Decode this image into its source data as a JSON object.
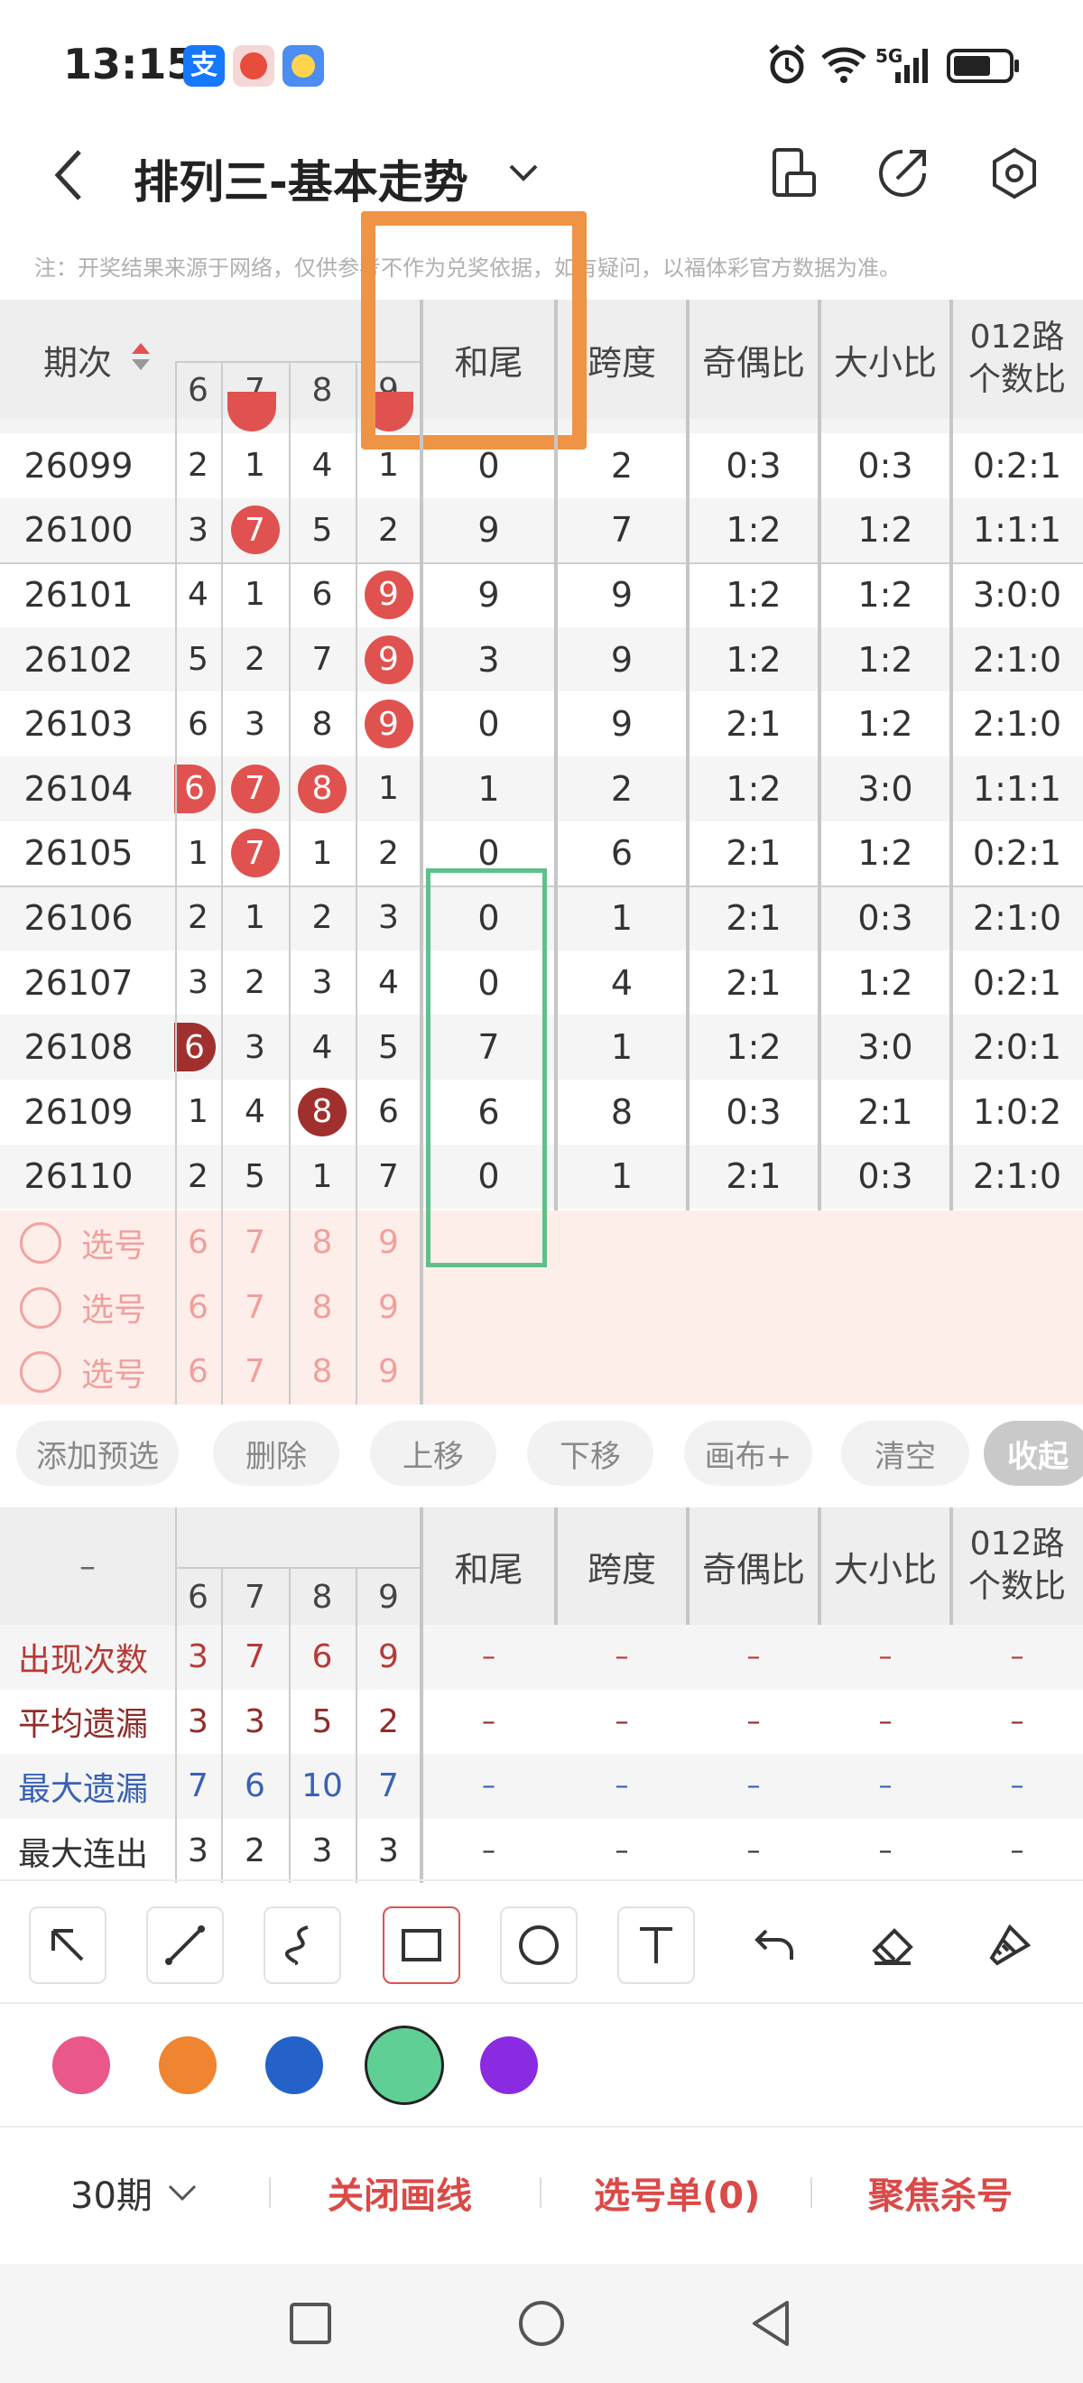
{
  "status": {
    "time": "13:15",
    "signal": "5G"
  },
  "header": {
    "title": "排列三-基本走势"
  },
  "note": "注：开奖结果来源于网络，仅供参考不作为兑奖依据，如有疑问，以福体彩官方数据为准。",
  "table": {
    "col_issue": "期次",
    "digit_cols": [
      "6",
      "7",
      "8",
      "9"
    ],
    "col_headers": [
      "和尾",
      "跨度",
      "奇偶比",
      "大小比"
    ],
    "col_012": [
      "012路",
      "个数比"
    ],
    "rows": [
      {
        "issue": "26099",
        "d": [
          "2",
          "1",
          "4",
          "1"
        ],
        "sum_tail": "0",
        "span": "2",
        "odd_even": "0:3",
        "big_small": "0:3",
        "r012": "0:2:1"
      },
      {
        "issue": "26100",
        "d": [
          "3",
          "7",
          "5",
          "2"
        ],
        "sum_tail": "9",
        "span": "7",
        "odd_even": "1:2",
        "big_small": "1:2",
        "r012": "1:1:1"
      },
      {
        "issue": "26101",
        "d": [
          "4",
          "1",
          "6",
          "9"
        ],
        "sum_tail": "9",
        "span": "9",
        "odd_even": "1:2",
        "big_small": "1:2",
        "r012": "3:0:0"
      },
      {
        "issue": "26102",
        "d": [
          "5",
          "2",
          "7",
          "9"
        ],
        "sum_tail": "3",
        "span": "9",
        "odd_even": "1:2",
        "big_small": "1:2",
        "r012": "2:1:0"
      },
      {
        "issue": "26103",
        "d": [
          "6",
          "3",
          "8",
          "9"
        ],
        "sum_tail": "0",
        "span": "9",
        "odd_even": "2:1",
        "big_small": "1:2",
        "r012": "2:1:0"
      },
      {
        "issue": "26104",
        "d": [
          "6",
          "7",
          "8",
          "1"
        ],
        "sum_tail": "1",
        "span": "2",
        "odd_even": "1:2",
        "big_small": "3:0",
        "r012": "1:1:1"
      },
      {
        "issue": "26105",
        "d": [
          "1",
          "7",
          "1",
          "2"
        ],
        "sum_tail": "0",
        "span": "6",
        "odd_even": "2:1",
        "big_small": "1:2",
        "r012": "0:2:1"
      },
      {
        "issue": "26106",
        "d": [
          "2",
          "1",
          "2",
          "3"
        ],
        "sum_tail": "0",
        "span": "1",
        "odd_even": "2:1",
        "big_small": "0:3",
        "r012": "2:1:0"
      },
      {
        "issue": "26107",
        "d": [
          "3",
          "2",
          "3",
          "4"
        ],
        "sum_tail": "0",
        "span": "4",
        "odd_even": "2:1",
        "big_small": "1:2",
        "r012": "0:2:1"
      },
      {
        "issue": "26108",
        "d": [
          "6",
          "3",
          "4",
          "5"
        ],
        "sum_tail": "7",
        "span": "1",
        "odd_even": "1:2",
        "big_small": "3:0",
        "r012": "2:0:1"
      },
      {
        "issue": "26109",
        "d": [
          "1",
          "4",
          "8",
          "6"
        ],
        "sum_tail": "6",
        "span": "8",
        "odd_even": "0:3",
        "big_small": "2:1",
        "r012": "1:0:2"
      },
      {
        "issue": "26110",
        "d": [
          "2",
          "5",
          "1",
          "7"
        ],
        "sum_tail": "0",
        "span": "1",
        "odd_even": "2:1",
        "big_small": "0:3",
        "r012": "2:1:0"
      }
    ],
    "pick_label": "选号",
    "pick_digits": [
      "6",
      "7",
      "8",
      "9"
    ]
  },
  "actions": [
    "添加预选",
    "删除",
    "上移",
    "下移",
    "画布+",
    "清空",
    "收起"
  ],
  "stats": {
    "dash": "–",
    "rows": [
      {
        "label": "出现次数",
        "d": [
          "3",
          "7",
          "6",
          "9"
        ],
        "color": "#b63a38"
      },
      {
        "label": "平均遗漏",
        "d": [
          "3",
          "3",
          "5",
          "2"
        ],
        "color": "#8f2d2b"
      },
      {
        "label": "最大遗漏",
        "d": [
          "7",
          "6",
          "10",
          "7"
        ],
        "color": "#3a62b3"
      },
      {
        "label": "最大连出",
        "d": [
          "3",
          "2",
          "3",
          "3"
        ],
        "color": "#333333"
      }
    ]
  },
  "tools": [
    "arrow-icon",
    "line-icon",
    "curve-icon",
    "rectangle-icon",
    "circle-icon",
    "text-icon",
    "undo-icon",
    "eraser-icon",
    "brush-icon"
  ],
  "palette": [
    "#e9578b",
    "#ef8431",
    "#2462c9",
    "#5fcf96",
    "#8a2be2"
  ],
  "bottom": {
    "period": "30期",
    "close_draw": "关闭画线",
    "pick_list": "选号单(0)",
    "focus_kill": "聚焦杀号"
  }
}
